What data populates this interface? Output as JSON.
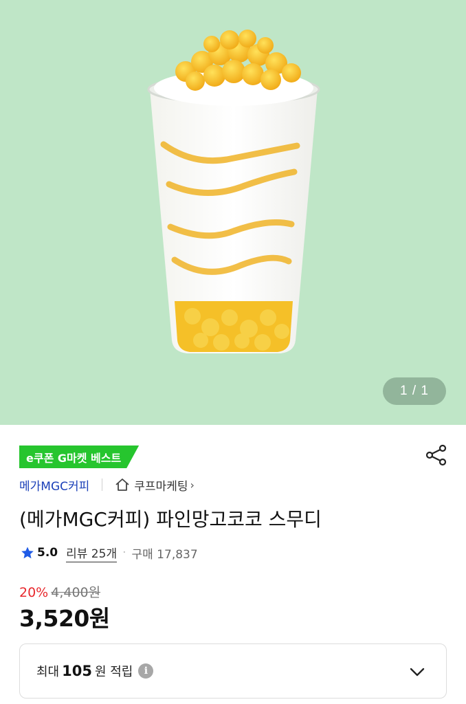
{
  "hero": {
    "counter": "1 / 1",
    "background": "#bfe6c7",
    "image_subject": "pineapple mango coconut smoothie in a clear cup"
  },
  "badge": {
    "label": "e쿠폰 G마켓 베스트",
    "color": "#26c52e"
  },
  "brand": {
    "name": "메가MGC커피",
    "seller": "쿠프마케팅",
    "seller_chevron": "›"
  },
  "product": {
    "title": "(메가MGC커피) 파인망고코코 스무디"
  },
  "rating": {
    "score": "5.0",
    "reviews": "리뷰 25개",
    "separator": "·",
    "purchases": "구매 17,837"
  },
  "pricing": {
    "discount": "20%",
    "original": "4,400원",
    "price": "3,520원",
    "discount_color": "#e8272c"
  },
  "points": {
    "label": "최대",
    "value": "105",
    "unit": "원 적립",
    "info_icon": "i"
  },
  "icons": {
    "share": "share-icon",
    "star": "star-icon",
    "store": "store-icon",
    "info": "info-icon",
    "chevron": "chevron-down-icon"
  }
}
